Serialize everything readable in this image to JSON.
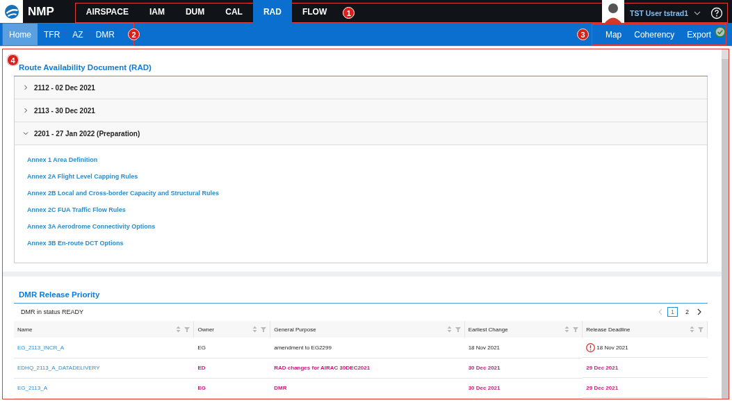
{
  "app": {
    "name": "NMP"
  },
  "top_nav": [
    {
      "label": "AIRSPACE",
      "selected": false
    },
    {
      "label": "IAM",
      "selected": false
    },
    {
      "label": "DUM",
      "selected": false
    },
    {
      "label": "CAL",
      "selected": false
    },
    {
      "label": "RAD",
      "selected": true
    },
    {
      "label": "FLOW",
      "selected": false
    }
  ],
  "user": {
    "name": "TST User tstrad1"
  },
  "sub_nav": [
    {
      "label": "Home",
      "selected": true
    },
    {
      "label": "TFR",
      "selected": false
    },
    {
      "label": "AZ",
      "selected": false
    },
    {
      "label": "DMR",
      "selected": false
    }
  ],
  "sub_nav_right": [
    {
      "label": "Map"
    },
    {
      "label": "Coherency"
    },
    {
      "label": "Export"
    }
  ],
  "status_ok": true,
  "annotations": [
    {
      "number": "1"
    },
    {
      "number": "2"
    },
    {
      "number": "3"
    },
    {
      "number": "4"
    }
  ],
  "rad_panel": {
    "title": "Route Availability Document (RAD)",
    "cycles": [
      {
        "label": "2112 - 02 Dec 2021",
        "expanded": false
      },
      {
        "label": "2113 - 30 Dec 2021",
        "expanded": false
      },
      {
        "label": "2201 - 27 Jan 2022 (Preparation)",
        "expanded": true,
        "links": [
          "Annex 1 Area Definition",
          "Annex 2A Flight Level Capping Rules",
          "Annex 2B Local and Cross-border Capacity and Structural Rules",
          "Annex 2C FUA Traffic Flow Rules",
          "Annex 3A Aerodrome Connectivity Options",
          "Annex 3B En-route DCT Options"
        ]
      }
    ]
  },
  "dmr_panel": {
    "title": "DMR Release Priority",
    "subtitle": "DMR in status READY",
    "pagination": [
      {
        "label": "1",
        "selected": true
      },
      {
        "label": "2",
        "selected": false
      }
    ],
    "columns": [
      "Name",
      "Owner",
      "General Purpose",
      "Earliest Change",
      "Release Deadline"
    ],
    "rows": [
      {
        "name": "EG_2113_INCR_A",
        "owner": "EG",
        "purpose": "amendment to EG2299",
        "earliest": "18 Nov 2021",
        "deadline": "18 Nov 2021",
        "highlighted": false,
        "alert": true
      },
      {
        "name": "EDHQ_2113_A_DATADELIVERY",
        "owner": "ED",
        "purpose": "RAD changes for AIRAC 30DEC2021",
        "earliest": "30 Dec 2021",
        "deadline": "29 Dec 2021",
        "highlighted": true,
        "alert": false
      },
      {
        "name": "EG_2113_A",
        "owner": "EG",
        "purpose": "DMR",
        "earliest": "30 Dec 2021",
        "deadline": "29 Dec 2021",
        "highlighted": true,
        "alert": false
      }
    ]
  }
}
